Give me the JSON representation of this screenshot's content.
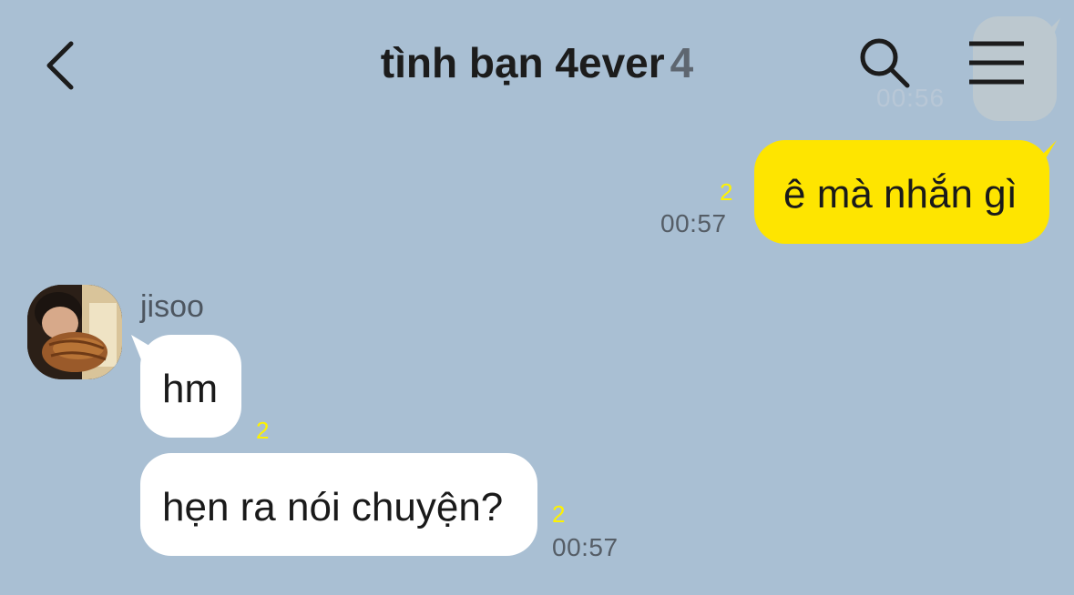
{
  "header": {
    "title": "tình bạn 4ever",
    "member_count": "4"
  },
  "previous": {
    "time": "00:56"
  },
  "messages": [
    {
      "sender": "me",
      "text": "ê mà nhắn gì",
      "unread": "2",
      "time": "00:57"
    },
    {
      "sender": "jisoo",
      "text": "hm",
      "unread": "2"
    },
    {
      "sender": "jisoo",
      "text": "hẹn ra nói chuyện?",
      "unread": "2",
      "time": "00:57"
    }
  ],
  "contact": {
    "name": "jisoo"
  },
  "colors": {
    "background": "#a9bfd3",
    "my_bubble": "#fee500",
    "other_bubble": "#ffffff",
    "unread": "#fef200"
  },
  "icons": [
    "back-icon",
    "search-icon",
    "menu-icon",
    "avatar"
  ]
}
